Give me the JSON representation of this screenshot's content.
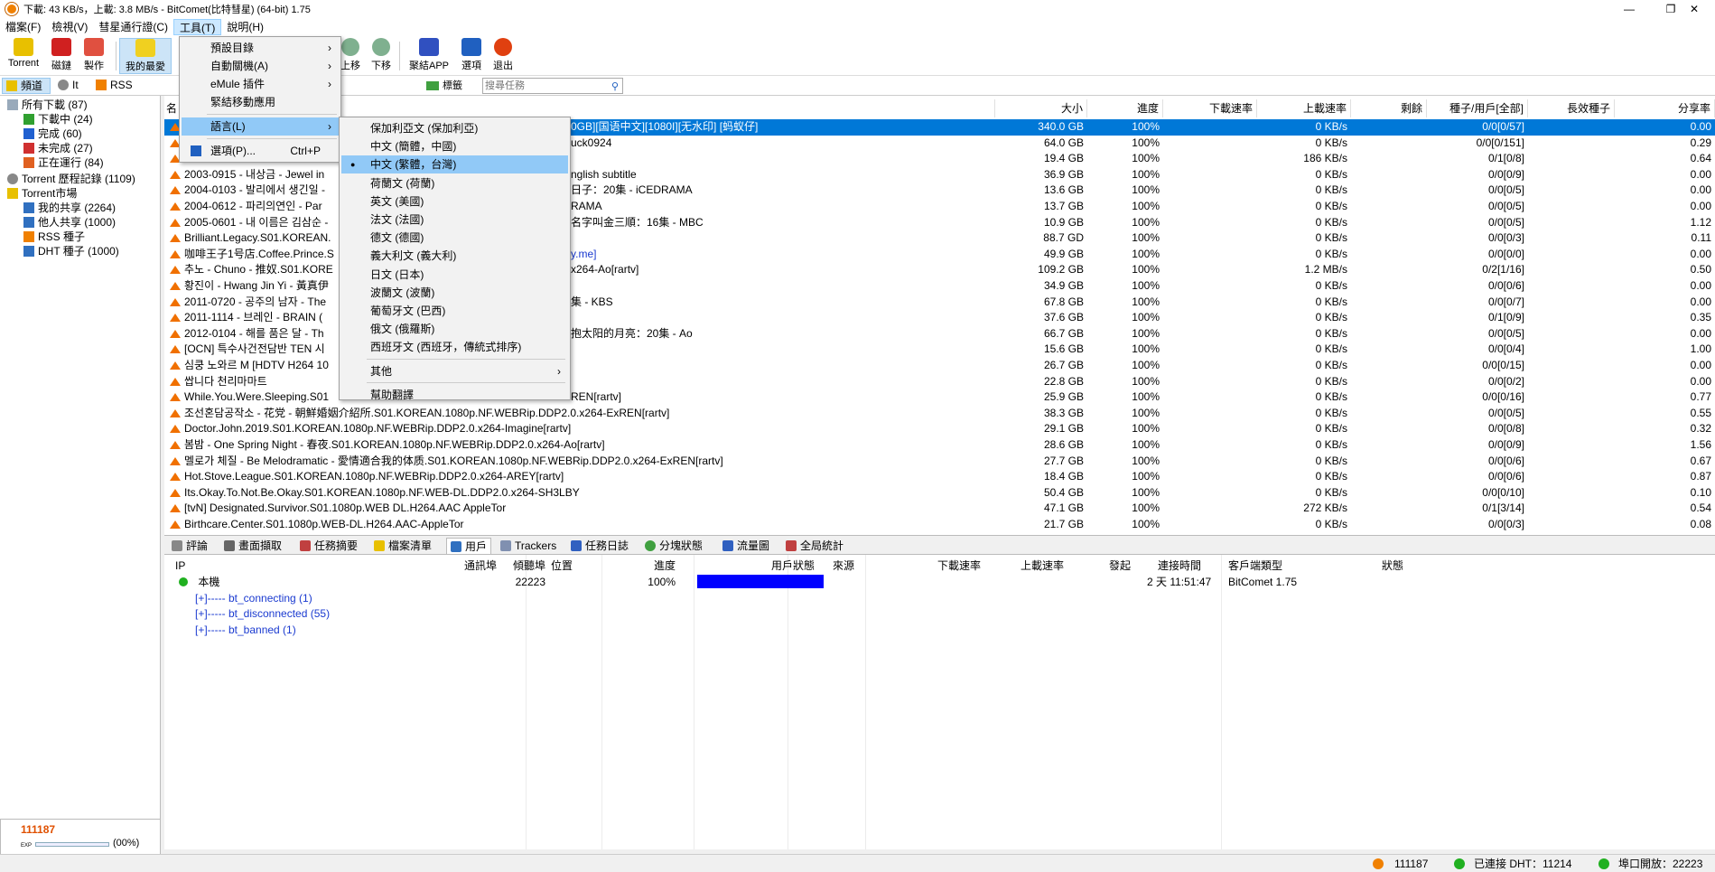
{
  "window": {
    "title": "下載: 43 KB/s，上載: 3.8 MB/s - BitComet(比特彗星) (64-bit) 1.75",
    "minimize": "—",
    "maximize": "❐",
    "close": "✕"
  },
  "menubar": {
    "items": [
      "檔案(F)",
      "檢視(V)",
      "彗星通行證(C)",
      "工具(T)",
      "說明(H)"
    ]
  },
  "toolbar": {
    "buttons": [
      "Torrent",
      "磁鏈",
      "製作",
      "我的最愛",
      "上移",
      "下移",
      "聚結APP",
      "選項",
      "退出"
    ]
  },
  "toolbar2": {
    "tabs": [
      "頻道",
      "It",
      "RSS"
    ],
    "tag_label": "標籤",
    "search_placeholder": "搜尋任務"
  },
  "sidebar": {
    "items": [
      {
        "label": "所有下載 (87)"
      },
      {
        "label": "下載中 (24)"
      },
      {
        "label": "完成 (60)"
      },
      {
        "label": "未完成 (27)"
      },
      {
        "label": "正在運行 (84)"
      },
      {
        "label": "Torrent 歷程記錄 (1109)"
      },
      {
        "label": "Torrent市場"
      },
      {
        "label": "我的共享 (2264)"
      },
      {
        "label": "他人共享 (1000)"
      },
      {
        "label": "RSS 種子"
      },
      {
        "label": "DHT 種子 (1000)"
      }
    ],
    "exp_value": "111187",
    "exp_label": "EXP",
    "exp_percent": "(00%)"
  },
  "table": {
    "headers": [
      "名",
      "大小",
      "進度",
      "下載速率",
      "上載速率",
      "剩餘",
      "種子/用戶[全部]",
      "長效種子",
      "分享率"
    ],
    "rows": [
      {
        "name": "",
        "size": "340.0 GB",
        "progress": "100%",
        "up": "0 KB/s",
        "seeds": "0/0[0/57]",
        "ratio": "0.00"
      },
      {
        "name": "",
        "size": "64.0 GB",
        "progress": "100%",
        "up": "0 KB/s",
        "seeds": "0/0[0/151]",
        "ratio": "0.29"
      },
      {
        "name": "",
        "size": "19.4 GB",
        "progress": "100%",
        "up": "186 KB/s",
        "seeds": "0/1[0/8]",
        "ratio": "0.64"
      },
      {
        "name": "2003-0915 - 내상금 - Jewel in",
        "size": "36.9 GB",
        "progress": "100%",
        "up": "0 KB/s",
        "seeds": "0/0[0/9]",
        "ratio": "0.00"
      },
      {
        "name": "2004-0103 - 발리에서 생긴일 -",
        "size": "13.6 GB",
        "progress": "100%",
        "up": "0 KB/s",
        "seeds": "0/0[0/5]",
        "ratio": "0.00"
      },
      {
        "name": "2004-0612 - 파리의연인 - Par",
        "size": "13.7 GB",
        "progress": "100%",
        "up": "0 KB/s",
        "seeds": "0/0[0/5]",
        "ratio": "0.00"
      },
      {
        "name": "2005-0601 - 내 이름은 김삼순 -",
        "size": "10.9 GB",
        "progress": "100%",
        "up": "0 KB/s",
        "seeds": "0/0[0/5]",
        "ratio": "1.12"
      },
      {
        "name": "Brilliant.Legacy.S01.KOREAN.",
        "size": "88.7 GD",
        "progress": "100%",
        "up": "0 KB/s",
        "seeds": "0/0[0/3]",
        "ratio": "0.11"
      },
      {
        "name": "咖啡王子1号店.Coffee.Prince.S",
        "size": "49.9 GB",
        "progress": "100%",
        "up": "0 KB/s",
        "seeds": "0/0[0/0]",
        "ratio": "0.00"
      },
      {
        "name": "추노 - Chuno - 推奴.S01.KORE",
        "size": "109.2 GB",
        "progress": "100%",
        "up": "1.2 MB/s",
        "seeds": "0/2[1/16]",
        "ratio": "0.50"
      },
      {
        "name": "황진이 - Hwang Jin Yi - 黃真伊",
        "size": "34.9 GB",
        "progress": "100%",
        "up": "0 KB/s",
        "seeds": "0/0[0/6]",
        "ratio": "0.00"
      },
      {
        "name": "2011-0720 - 공주의 남자 - The",
        "size": "67.8 GB",
        "progress": "100%",
        "up": "0 KB/s",
        "seeds": "0/0[0/7]",
        "ratio": "0.00"
      },
      {
        "name": "2011-1114 - 브레인 - BRAIN (",
        "size": "37.6 GB",
        "progress": "100%",
        "up": "0 KB/s",
        "seeds": "0/1[0/9]",
        "ratio": "0.35"
      },
      {
        "name": "2012-0104 - 해를 품은 달 - Th",
        "size": "66.7 GB",
        "progress": "100%",
        "up": "0 KB/s",
        "seeds": "0/0[0/5]",
        "ratio": "0.00"
      },
      {
        "name": "[OCN] 특수사건전담반 TEN 시",
        "size": "15.6 GB",
        "progress": "100%",
        "up": "0 KB/s",
        "seeds": "0/0[0/4]",
        "ratio": "1.00"
      },
      {
        "name": "심쿵 노와르 M [HDTV H264 10",
        "size": "26.7 GB",
        "progress": "100%",
        "up": "0 KB/s",
        "seeds": "0/0[0/15]",
        "ratio": "0.00"
      },
      {
        "name": "쌉니다 천리마마트",
        "size": "22.8 GB",
        "progress": "100%",
        "up": "0 KB/s",
        "seeds": "0/0[0/2]",
        "ratio": "0.00"
      },
      {
        "name": "While.You.Were.Sleeping.S01",
        "size": "25.9 GB",
        "progress": "100%",
        "up": "0 KB/s",
        "seeds": "0/0[0/16]",
        "ratio": "0.77"
      },
      {
        "name": "조선혼담공작소 - 花党 - 朝鮮婚姻介紹所.S01.KOREAN.1080p.NF.WEBRip.DDP2.0.x264-ExREN[rartv]",
        "size": "38.3 GB",
        "progress": "100%",
        "up": "0 KB/s",
        "seeds": "0/0[0/5]",
        "ratio": "0.55"
      },
      {
        "name": "Doctor.John.2019.S01.KOREAN.1080p.NF.WEBRip.DDP2.0.x264-Imagine[rartv]",
        "size": "29.1 GB",
        "progress": "100%",
        "up": "0 KB/s",
        "seeds": "0/0[0/8]",
        "ratio": "0.32"
      },
      {
        "name": "봄밤 - One Spring Night - 春夜.S01.KOREAN.1080p.NF.WEBRip.DDP2.0.x264-Ao[rartv]",
        "size": "28.6 GB",
        "progress": "100%",
        "up": "0 KB/s",
        "seeds": "0/0[0/9]",
        "ratio": "1.56"
      },
      {
        "name": "멜로가 체질 - Be Melodramatic - 愛情適合我的体质.S01.KOREAN.1080p.NF.WEBRip.DDP2.0.x264-ExREN[rartv]",
        "size": "27.7 GB",
        "progress": "100%",
        "up": "0 KB/s",
        "seeds": "0/0[0/6]",
        "ratio": "0.67"
      },
      {
        "name": "Hot.Stove.League.S01.KOREAN.1080p.NF.WEBRip.DDP2.0.x264-AREY[rartv]",
        "size": "18.4 GB",
        "progress": "100%",
        "up": "0 KB/s",
        "seeds": "0/0[0/6]",
        "ratio": "0.87"
      },
      {
        "name": "Its.Okay.To.Not.Be.Okay.S01.KOREAN.1080p.NF.WEB-DL.DDP2.0.x264-SH3LBY",
        "size": "50.4 GB",
        "progress": "100%",
        "up": "0 KB/s",
        "seeds": "0/0[0/10]",
        "ratio": "0.10"
      },
      {
        "name": "[tvN] Designated.Survivor.S01.1080p.WEB DL.H264.AAC AppleTor",
        "size": "47.1 GB",
        "progress": "100%",
        "up": "272 KB/s",
        "seeds": "0/1[3/14]",
        "ratio": "0.54"
      },
      {
        "name": "Birthcare.Center.S01.1080p.WEB-DL.H264.AAC-AppleTor",
        "size": "21.7 GB",
        "progress": "100%",
        "up": "0 KB/s",
        "seeds": "0/0[0/3]",
        "ratio": "0.08"
      }
    ],
    "hidden_fragments": [
      "0GB][国语中文][1080I][无水印] [蚂蚁仔]",
      "uck0924",
      "nglish subtitle",
      "日子：20集 - iCEDRAMA",
      "RAMA",
      "名字叫金三順：16集 - MBC",
      "y.me]",
      "x264-Ao[rartv]",
      "集 - KBS",
      "抱太阳的月亮：20集 - Ao",
      "REN[rartv]"
    ]
  },
  "detail_tabs": [
    "評論",
    "畫面擷取",
    "任務摘要",
    "檔案清單",
    "用戶",
    "Trackers",
    "任務日誌",
    "分塊狀態",
    "流量圖",
    "全局統計"
  ],
  "peers": {
    "headers": [
      "IP",
      "通訊埠",
      "傾聽埠",
      "位置",
      "進度",
      "用戶狀態",
      "來源",
      "下載速率",
      "上載速率",
      "發起",
      "連接時間",
      "客戶端類型",
      "狀態"
    ],
    "local": {
      "ip": "本機",
      "port": "22223",
      "progress": "100%",
      "time": "2 天 11:51:47",
      "client": "BitComet 1.75"
    },
    "groups": [
      "[+]----- bt_connecting (1)",
      "[+]----- bt_disconnected (55)",
      "[+]----- bt_banned (1)"
    ]
  },
  "statusbar": {
    "exp": "111187",
    "dht": "已連接 DHT：11214",
    "port": "埠口開放：22223"
  },
  "tools_menu": {
    "items": [
      "預設目錄",
      "自動關機(A)",
      "eMule 插件",
      "緊結移動應用",
      "語言(L)",
      "選項(P)..."
    ],
    "shortcut": "Ctrl+P"
  },
  "lang_menu": {
    "items": [
      "保加利亞文 (保加利亞)",
      "中文 (簡體，中國)",
      "中文 (繁體，台灣)",
      "荷蘭文 (荷蘭)",
      "英文 (美國)",
      "法文 (法國)",
      "德文 (德國)",
      "義大利文 (義大利)",
      "日文 (日本)",
      "波蘭文 (波蘭)",
      "葡萄牙文 (巴西)",
      "俄文 (俄羅斯)",
      "西班牙文 (西班牙，傳統式排序)",
      "其他",
      "幫助翻譯"
    ],
    "checked_mark": "●"
  },
  "colors": {
    "selection": "#0078d7",
    "menu_highlight": "#91c9f7",
    "progress_fill": "#0000ff",
    "upload_arrow": "#f07000"
  }
}
